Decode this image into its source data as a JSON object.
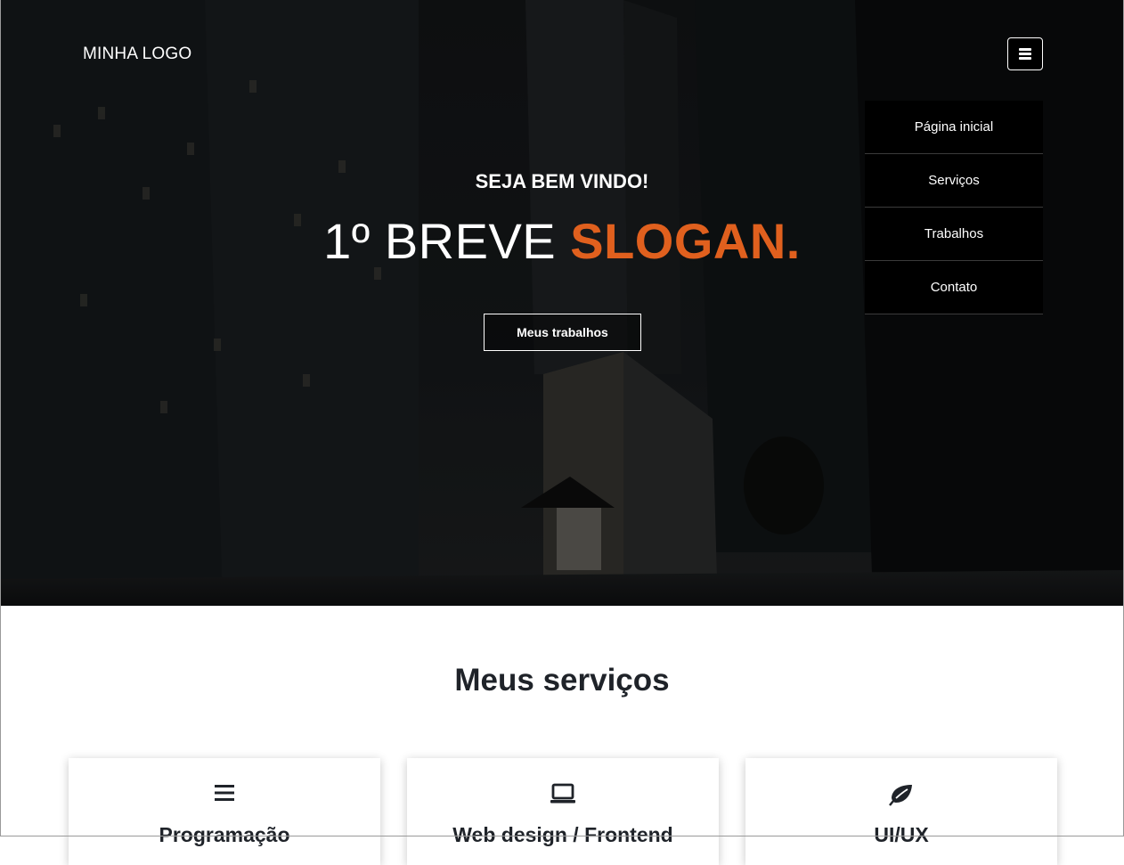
{
  "header": {
    "logo": "MINHA LOGO",
    "menu_icon": "hamburger-icon"
  },
  "nav": {
    "items": [
      {
        "label": "Página inicial"
      },
      {
        "label": "Serviços"
      },
      {
        "label": "Trabalhos"
      },
      {
        "label": "Contato"
      }
    ]
  },
  "hero": {
    "welcome": "SEJA BEM VINDO!",
    "slogan_prefix": "1º BREVE ",
    "slogan_accent": "SLOGAN.",
    "cta_label": "Meus trabalhos",
    "accent_color": "#e0601e"
  },
  "services": {
    "title": "Meus serviços",
    "cards": [
      {
        "icon": "bars-icon",
        "title": "Programação"
      },
      {
        "icon": "laptop-icon",
        "title": "Web design / Frontend"
      },
      {
        "icon": "leaf-icon",
        "title": "UI/UX"
      }
    ]
  }
}
